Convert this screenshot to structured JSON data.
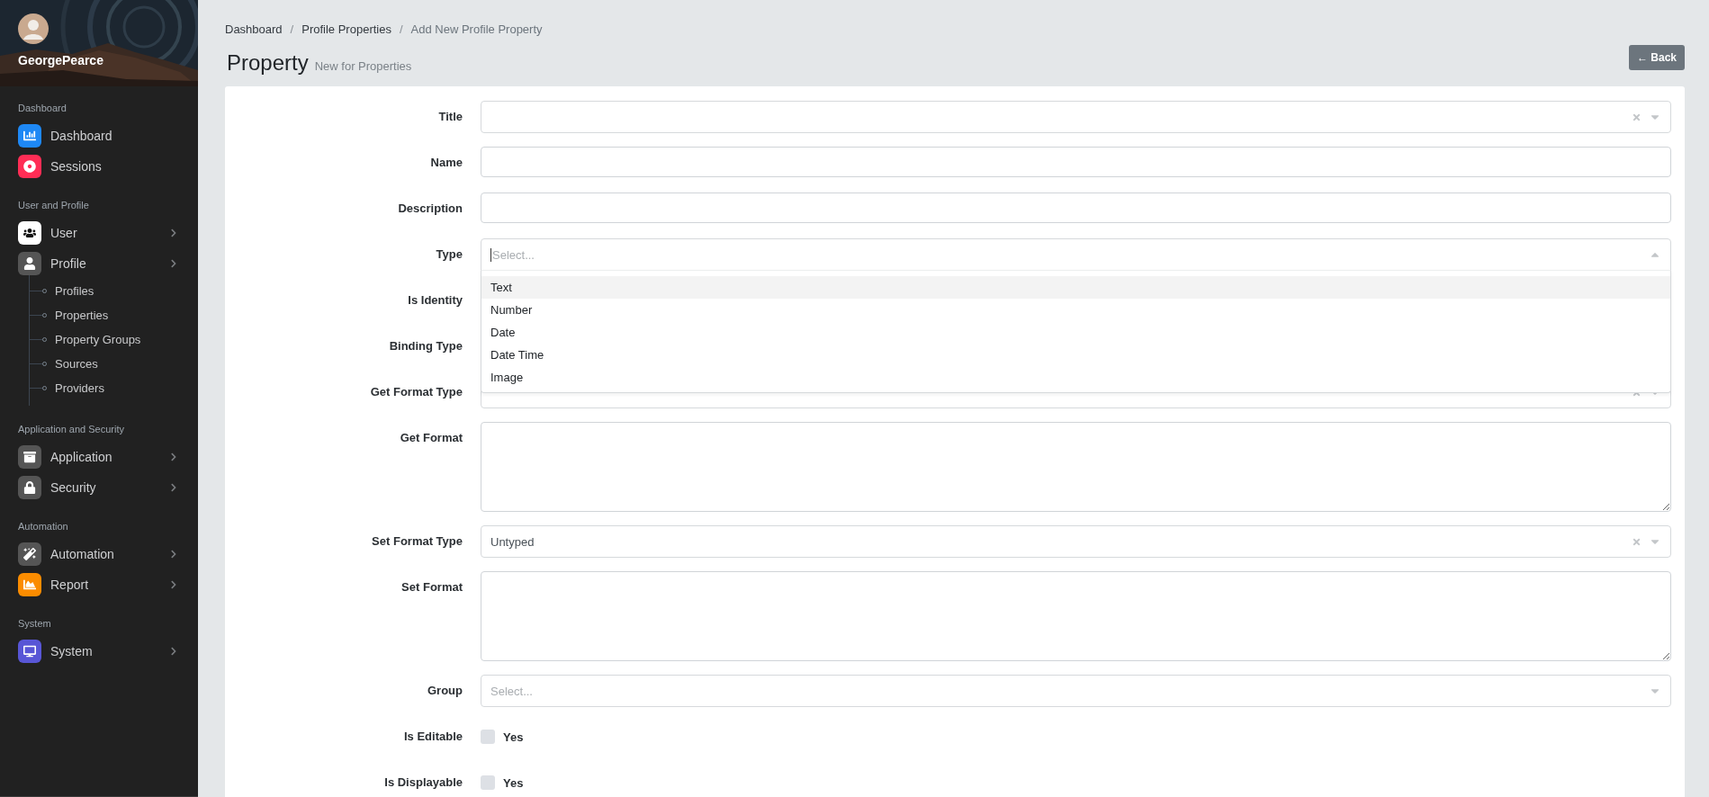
{
  "sidebar": {
    "user": {
      "name": "GeorgePearce"
    },
    "sections": [
      {
        "label": "Dashboard",
        "items": [
          {
            "label": "Dashboard",
            "color": "#1e88f5"
          },
          {
            "label": "Sessions",
            "color": "#ff2d55"
          }
        ]
      },
      {
        "label": "User and Profile",
        "items": [
          {
            "label": "User",
            "color": "#ffffff",
            "expandable": true
          },
          {
            "label": "Profile",
            "color": "#555555",
            "expandable": true,
            "expanded": true,
            "children": [
              {
                "label": "Profiles"
              },
              {
                "label": "Properties"
              },
              {
                "label": "Property Groups"
              },
              {
                "label": "Sources"
              },
              {
                "label": "Providers"
              }
            ]
          }
        ]
      },
      {
        "label": "Application and Security",
        "items": [
          {
            "label": "Application",
            "color": "#555555",
            "expandable": true
          },
          {
            "label": "Security",
            "color": "#555555",
            "expandable": true
          }
        ]
      },
      {
        "label": "Automation",
        "items": [
          {
            "label": "Automation",
            "color": "#555555",
            "expandable": true
          },
          {
            "label": "Report",
            "color": "#fb8c00",
            "expandable": true
          }
        ]
      },
      {
        "label": "System",
        "items": [
          {
            "label": "System",
            "color": "#5856d6",
            "expandable": true
          }
        ]
      }
    ]
  },
  "breadcrumb": [
    {
      "label": "Dashboard",
      "current": false
    },
    {
      "separator": "/",
      "label": "Profile Properties",
      "current": false
    },
    {
      "separator": "/",
      "label": "Add New Profile Property",
      "current": true
    }
  ],
  "page": {
    "title": "Property",
    "subtitle": "New for Properties",
    "back_button": "← Back"
  },
  "form": [
    {
      "label": "Title",
      "kind": "select",
      "clearable": true
    },
    {
      "label": "Name",
      "kind": "text"
    },
    {
      "label": "Description",
      "kind": "text"
    },
    {
      "label": "Type",
      "kind": "select",
      "placeholder": "Select...",
      "open": true,
      "options": [
        {
          "label": "Text",
          "selected": true
        },
        {
          "label": "Number",
          "selected": false
        },
        {
          "label": "Date",
          "selected": false
        },
        {
          "label": "Date Time",
          "selected": false
        },
        {
          "label": "Image",
          "selected": false
        }
      ]
    },
    {
      "label": "Is Identity",
      "kind": "hidden"
    },
    {
      "label": "Binding Type",
      "kind": "hidden"
    },
    {
      "label": "Get Format Type",
      "kind": "select",
      "clearable": true
    },
    {
      "label": "Get Format",
      "kind": "textarea"
    },
    {
      "label": "Set Format Type",
      "kind": "select",
      "value": "Untyped",
      "clearable": true
    },
    {
      "label": "Set Format",
      "kind": "textarea"
    },
    {
      "label": "Group",
      "kind": "select",
      "placeholder": "Select...",
      "clearable": false
    },
    {
      "label": "Is Editable",
      "kind": "checkbox",
      "text": "Yes",
      "checked": false
    },
    {
      "label": "Is Displayable",
      "kind": "checkbox",
      "text": "Yes",
      "checked": false
    }
  ]
}
